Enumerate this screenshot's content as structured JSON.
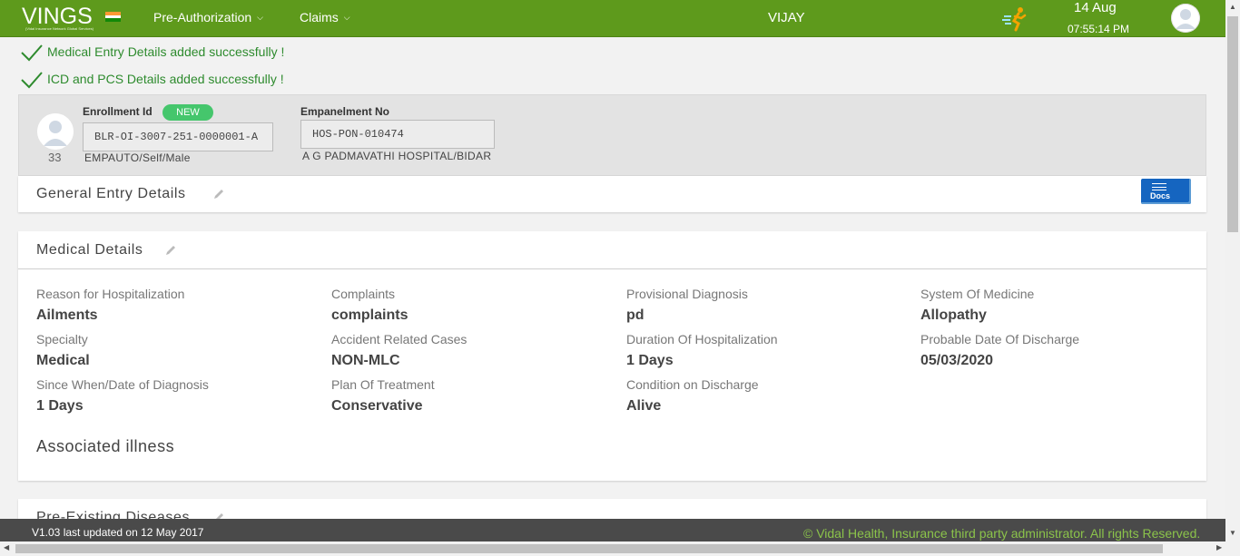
{
  "header": {
    "logo_text": "VINGS",
    "logo_subtitle": "(Vidal Insurance Network Global Services)",
    "nav": [
      {
        "label": "Pre-Authorization"
      },
      {
        "label": "Claims"
      }
    ],
    "user_name": "VIJAY",
    "date": "14 Aug",
    "time": "07:55:14 PM",
    "brand_color": "#5e9a1c",
    "icons": [
      "india-flag-icon",
      "runner-icon",
      "user-avatar-icon"
    ]
  },
  "messages": [
    "Medical Entry Details added successfully !",
    "ICD and PCS Details added successfully !"
  ],
  "member": {
    "age": "33",
    "enrollment_label": "Enrollment Id",
    "badge": "NEW",
    "enrollment_id": "BLR-OI-3007-251-0000001-A",
    "enrollment_sub": "EMPAUTO/Self/Male",
    "empanelment_label": "Empanelment No",
    "empanelment_no": "HOS-PON-010474",
    "hospital": "A G PADMAVATHI HOSPITAL/BIDAR"
  },
  "general": {
    "title": "General Entry Details",
    "docs_label": "Docs"
  },
  "medical": {
    "title": "Medical Details",
    "fields": [
      {
        "label": "Reason for Hospitalization",
        "value": "Ailments"
      },
      {
        "label": "Complaints",
        "value": "complaints"
      },
      {
        "label": "Provisional Diagnosis",
        "value": "pd"
      },
      {
        "label": "System Of Medicine",
        "value": "Allopathy"
      },
      {
        "label": "Specialty",
        "value": "Medical"
      },
      {
        "label": "Accident Related Cases",
        "value": "NON-MLC"
      },
      {
        "label": "Duration Of Hospitalization",
        "value": "1 Days"
      },
      {
        "label": "Probable Date Of Discharge",
        "value": "05/03/2020"
      },
      {
        "label": "Since When/Date of Diagnosis",
        "value": "1 Days"
      },
      {
        "label": "Plan Of Treatment",
        "value": "Conservative"
      },
      {
        "label": "Condition on Discharge",
        "value": "Alive"
      }
    ],
    "associated_title": "Associated illness"
  },
  "preexisting": {
    "title": "Pre-Existing Diseases"
  },
  "footer": {
    "version": "V1.03 last updated on 12 May 2017",
    "copyright": "© Vidal Health, Insurance third party administrator. All rights Reserved."
  }
}
